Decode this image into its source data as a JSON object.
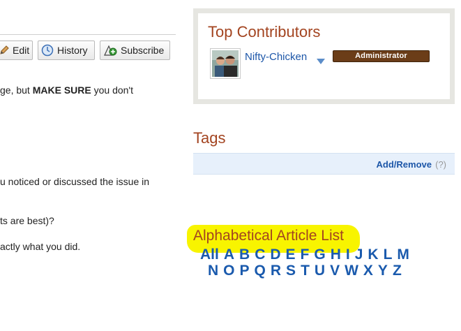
{
  "toolbar": {
    "edit_label": "Edit",
    "history_label": "History",
    "subscribe_label": "Subscribe"
  },
  "content": {
    "line1_pre": "ge, but ",
    "line1_bold": "MAKE SURE",
    "line1_post": " you don't",
    "line2": "u noticed or discussed the issue in",
    "line3": "ts are best)?",
    "line4": "actly what you did."
  },
  "contributors": {
    "title": "Top Contributors",
    "user_name": "Nifty-Chicken",
    "role": "Administrator"
  },
  "tags": {
    "title": "Tags",
    "add_remove": "Add/Remove",
    "help": "(?)"
  },
  "alphabet": {
    "title": "Alphabetical Article List",
    "row1": [
      "All",
      "A",
      "B",
      "C",
      "D",
      "E",
      "F",
      "G",
      "H",
      "I",
      "J",
      "K",
      "L",
      "M"
    ],
    "row2": [
      "N",
      "O",
      "P",
      "Q",
      "R",
      "S",
      "T",
      "U",
      "V",
      "W",
      "X",
      "Y",
      "Z"
    ]
  },
  "colors": {
    "heading": "#a34420",
    "link": "#1a5aad",
    "highlight": "#f8f400",
    "badge": "#6b3d18"
  }
}
